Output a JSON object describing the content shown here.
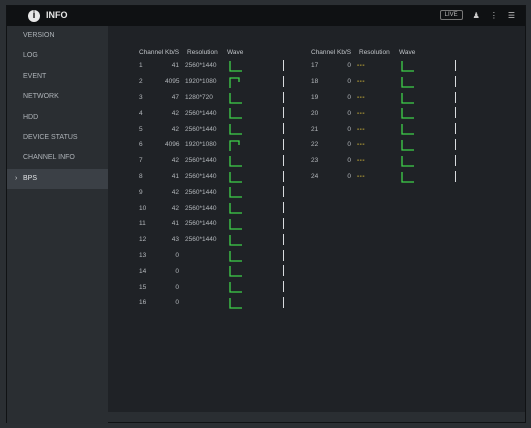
{
  "window": {
    "title": "INFO",
    "icon": "info-icon"
  },
  "toolbar": {
    "live_label": "LIVE",
    "user_glyph": "♟",
    "more_glyph": "⋮",
    "menu_glyph": "☰"
  },
  "sidebar": {
    "items": [
      {
        "label": "VERSION",
        "active": false
      },
      {
        "label": "LOG",
        "active": false
      },
      {
        "label": "EVENT",
        "active": false
      },
      {
        "label": "NETWORK",
        "active": false
      },
      {
        "label": "HDD",
        "active": false
      },
      {
        "label": "DEVICE STATUS",
        "active": false
      },
      {
        "label": "CHANNEL INFO",
        "active": false
      },
      {
        "label": "BPS",
        "active": true
      }
    ]
  },
  "bps": {
    "headers": {
      "channel": "Channel",
      "kbs": "Kb/S",
      "resolution": "Resolution",
      "wave": "Wave"
    },
    "left_rows": [
      {
        "channel": "1",
        "kbs": "41",
        "resolution": "2560*1440",
        "wave": "low"
      },
      {
        "channel": "2",
        "kbs": "4095",
        "resolution": "1920*1080",
        "wave": "high"
      },
      {
        "channel": "3",
        "kbs": "47",
        "resolution": "1280*720",
        "wave": "low"
      },
      {
        "channel": "4",
        "kbs": "42",
        "resolution": "2560*1440",
        "wave": "low"
      },
      {
        "channel": "5",
        "kbs": "42",
        "resolution": "2560*1440",
        "wave": "low"
      },
      {
        "channel": "6",
        "kbs": "4096",
        "resolution": "1920*1080",
        "wave": "high"
      },
      {
        "channel": "7",
        "kbs": "42",
        "resolution": "2560*1440",
        "wave": "low"
      },
      {
        "channel": "8",
        "kbs": "41",
        "resolution": "2560*1440",
        "wave": "low"
      },
      {
        "channel": "9",
        "kbs": "42",
        "resolution": "2560*1440",
        "wave": "low"
      },
      {
        "channel": "10",
        "kbs": "42",
        "resolution": "2560*1440",
        "wave": "low"
      },
      {
        "channel": "11",
        "kbs": "41",
        "resolution": "2560*1440",
        "wave": "low"
      },
      {
        "channel": "12",
        "kbs": "43",
        "resolution": "2560*1440",
        "wave": "low"
      },
      {
        "channel": "13",
        "kbs": "0",
        "resolution": "",
        "wave": "low"
      },
      {
        "channel": "14",
        "kbs": "0",
        "resolution": "",
        "wave": "low"
      },
      {
        "channel": "15",
        "kbs": "0",
        "resolution": "",
        "wave": "low"
      },
      {
        "channel": "16",
        "kbs": "0",
        "resolution": "",
        "wave": "low"
      }
    ],
    "right_rows": [
      {
        "channel": "17",
        "kbs": "0",
        "resolution": "---",
        "wave": "low"
      },
      {
        "channel": "18",
        "kbs": "0",
        "resolution": "---",
        "wave": "low"
      },
      {
        "channel": "19",
        "kbs": "0",
        "resolution": "---",
        "wave": "low"
      },
      {
        "channel": "20",
        "kbs": "0",
        "resolution": "---",
        "wave": "low"
      },
      {
        "channel": "21",
        "kbs": "0",
        "resolution": "---",
        "wave": "low"
      },
      {
        "channel": "22",
        "kbs": "0",
        "resolution": "---",
        "wave": "low"
      },
      {
        "channel": "23",
        "kbs": "0",
        "resolution": "---",
        "wave": "low"
      },
      {
        "channel": "24",
        "kbs": "0",
        "resolution": "---",
        "wave": "low"
      }
    ],
    "colors": {
      "wave": "#3fd24a",
      "placeholder": "#e0c23a"
    }
  }
}
